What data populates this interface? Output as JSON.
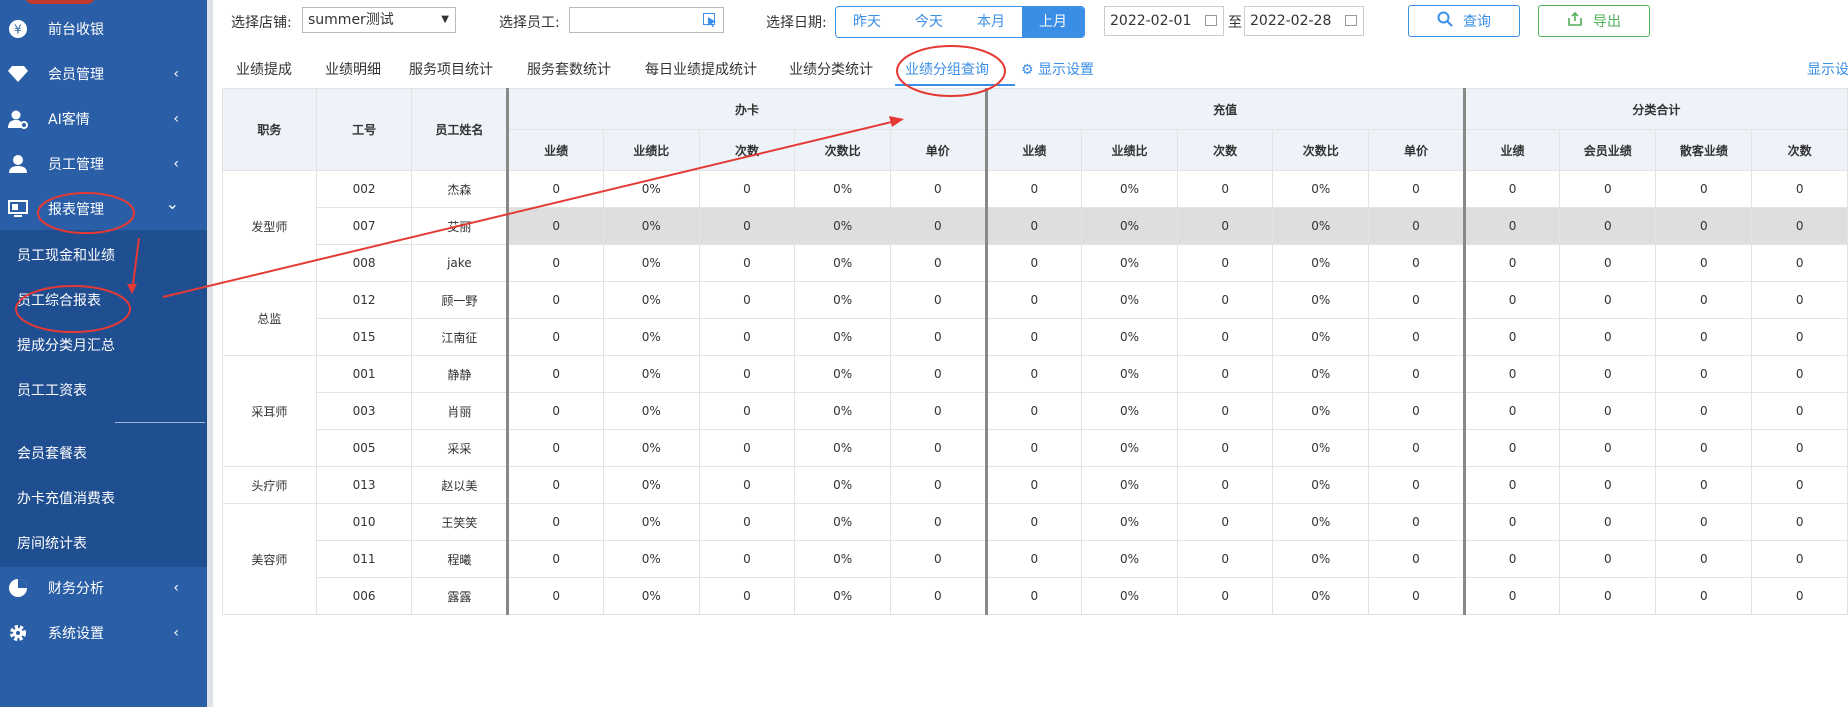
{
  "sidebar": {
    "items": [
      {
        "label": "前台收银",
        "icon": "yen-icon",
        "chevron": ""
      },
      {
        "label": "会员管理",
        "icon": "diamond-icon",
        "chevron": "‹"
      },
      {
        "label": "AI客情",
        "icon": "user-settings-icon",
        "chevron": "‹"
      },
      {
        "label": "员工管理",
        "icon": "user-icon",
        "chevron": "‹"
      },
      {
        "label": "报表管理",
        "icon": "monitor-icon",
        "chevron": "⌄"
      }
    ],
    "sub_items": [
      "员工现金和业绩",
      "员工综合报表",
      "提成分类月汇总",
      "员工工资表",
      "会员套餐表",
      "办卡充值消费表",
      "房间统计表"
    ],
    "bottom_items": [
      {
        "label": "财务分析",
        "icon": "pie-chart-icon",
        "chevron": "‹"
      },
      {
        "label": "系统设置",
        "icon": "gear-icon",
        "chevron": "‹"
      }
    ]
  },
  "filters": {
    "store_label": "选择店铺:",
    "store_value": "summer测试",
    "staff_label": "选择员工:",
    "staff_value": "",
    "date_label": "选择日期:",
    "date_buttons": [
      "昨天",
      "今天",
      "本月",
      "上月"
    ],
    "date_active": "上月",
    "date_from": "2022-02-01",
    "date_sep": "至",
    "date_to": "2022-02-28",
    "query_label": "查询",
    "export_label": "导出"
  },
  "tabs": [
    "业绩提成",
    "业绩明细",
    "服务项目统计",
    "服务套数统计",
    "每日业绩提成统计",
    "业绩分类统计",
    "业绩分组查询"
  ],
  "active_tab": "业绩分组查询",
  "display_settings": "显示设置",
  "display_settings_right": "显示设",
  "table": {
    "fixed_headers": [
      "职务",
      "工号",
      "员工姓名"
    ],
    "groups": [
      {
        "name": "办卡",
        "cols": [
          "业绩",
          "业绩比",
          "次数",
          "次数比",
          "单价"
        ]
      },
      {
        "name": "充值",
        "cols": [
          "业绩",
          "业绩比",
          "次数",
          "次数比",
          "单价"
        ]
      },
      {
        "name": "分类合计",
        "cols": [
          "业绩",
          "会员业绩",
          "散客业绩",
          "次数"
        ]
      }
    ],
    "positions": [
      {
        "name": "发型师",
        "staff": [
          {
            "id": "002",
            "name": "杰森"
          },
          {
            "id": "007",
            "name": "艾丽"
          },
          {
            "id": "008",
            "name": "jake"
          }
        ]
      },
      {
        "name": "总监",
        "staff": [
          {
            "id": "012",
            "name": "顾一野"
          },
          {
            "id": "015",
            "name": "江南征"
          }
        ]
      },
      {
        "name": "采耳师",
        "staff": [
          {
            "id": "001",
            "name": "静静"
          },
          {
            "id": "003",
            "name": "肖丽"
          },
          {
            "id": "005",
            "name": "采采"
          }
        ]
      },
      {
        "name": "头疗师",
        "staff": [
          {
            "id": "013",
            "name": "赵以美"
          }
        ]
      },
      {
        "name": "美容师",
        "staff": [
          {
            "id": "010",
            "name": "王笑笑"
          },
          {
            "id": "011",
            "name": "程曦"
          },
          {
            "id": "006",
            "name": "露露"
          }
        ]
      }
    ],
    "row_values": [
      "0",
      "0%",
      "0",
      "0%",
      "0",
      "0",
      "0%",
      "0",
      "0%",
      "0",
      "0",
      "0",
      "0",
      "0"
    ],
    "highlight_row_id": "007"
  },
  "colors": {
    "sidebar": "#2a5ea6",
    "accent": "#3a8ee6",
    "export": "#52b05a",
    "annotation": "#e53935"
  }
}
